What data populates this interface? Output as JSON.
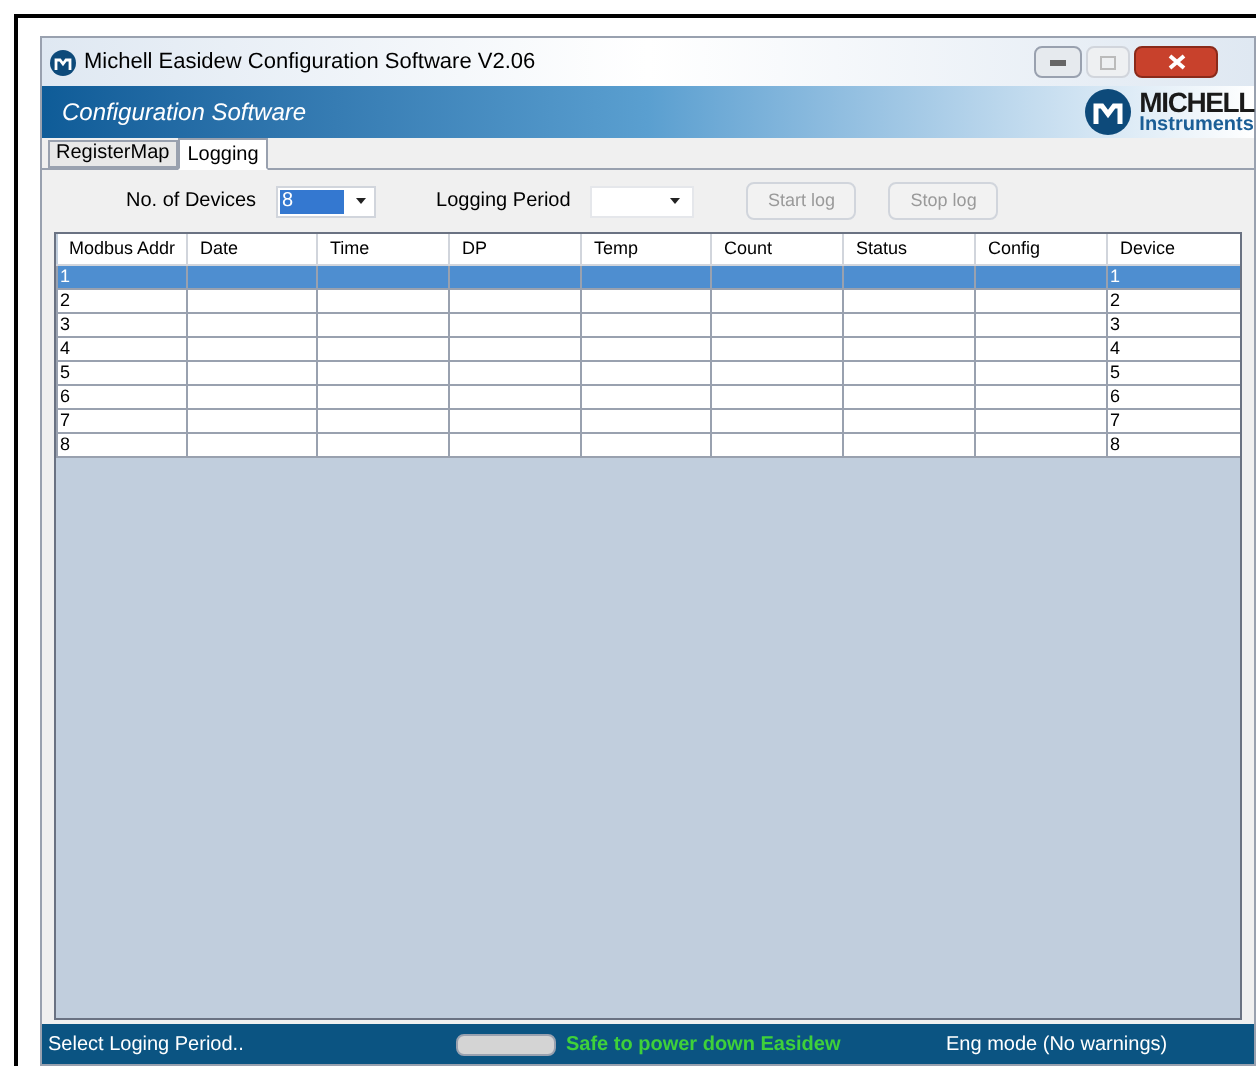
{
  "window": {
    "title": "Michell Easidew Configuration Software V2.06"
  },
  "banner": {
    "title": "Configuration Software",
    "logo_name": "MICHELL",
    "logo_sub": "Instruments"
  },
  "tabs": [
    {
      "label": "RegisterMap",
      "selected": false
    },
    {
      "label": "Logging",
      "selected": true
    }
  ],
  "toolbar": {
    "devices_label": "No. of Devices",
    "devices_value": "8",
    "period_label": "Logging Period",
    "buttons": [
      {
        "label": "Start log",
        "disabled": true
      },
      {
        "label": "Stop log",
        "disabled": true
      }
    ]
  },
  "table": {
    "columns": [
      "Modbus Addr",
      "Date",
      "Time",
      "DP",
      "Temp",
      "Count",
      "Status",
      "Config",
      "Device"
    ],
    "rows": [
      {
        "cells": [
          "1",
          "",
          "",
          "",
          "",
          "",
          "",
          "",
          "1"
        ],
        "selected": true
      },
      {
        "cells": [
          "2",
          "",
          "",
          "",
          "",
          "",
          "",
          "",
          "2"
        ],
        "selected": false
      },
      {
        "cells": [
          "3",
          "",
          "",
          "",
          "",
          "",
          "",
          "",
          "3"
        ],
        "selected": false
      },
      {
        "cells": [
          "4",
          "",
          "",
          "",
          "",
          "",
          "",
          "",
          "4"
        ],
        "selected": false
      },
      {
        "cells": [
          "5",
          "",
          "",
          "",
          "",
          "",
          "",
          "",
          "5"
        ],
        "selected": false
      },
      {
        "cells": [
          "6",
          "",
          "",
          "",
          "",
          "",
          "",
          "",
          "6"
        ],
        "selected": false
      },
      {
        "cells": [
          "7",
          "",
          "",
          "",
          "",
          "",
          "",
          "",
          "7"
        ],
        "selected": false
      },
      {
        "cells": [
          "8",
          "",
          "",
          "",
          "",
          "",
          "",
          "",
          "8"
        ],
        "selected": false
      }
    ]
  },
  "status_bar": {
    "message": "Select Loging Period..",
    "safe_message": "Safe to power down Easidew",
    "mode": "Eng mode (No warnings)"
  }
}
